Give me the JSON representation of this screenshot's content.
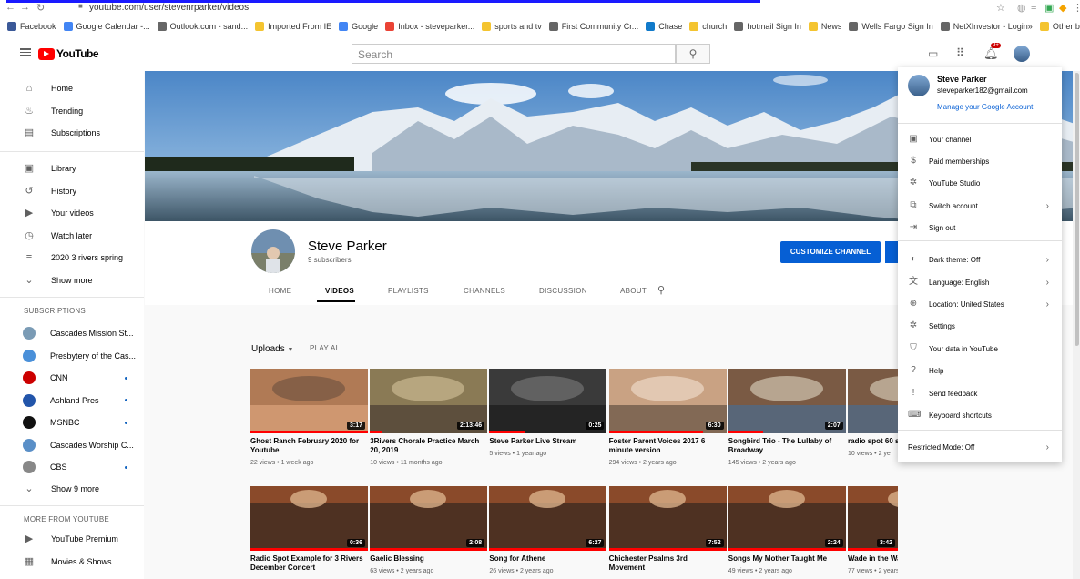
{
  "browser": {
    "url": "youtube.com/user/stevenrparker/videos",
    "bookmarks": [
      {
        "label": "Facebook",
        "color": "#3b5998"
      },
      {
        "label": "Google Calendar -...",
        "color": "#4285f4"
      },
      {
        "label": "Outlook.com - sand...",
        "color": "#666666"
      },
      {
        "label": "Imported From IE",
        "color": "#f4c430"
      },
      {
        "label": "Google",
        "color": "#4285f4"
      },
      {
        "label": "Inbox - steveparker...",
        "color": "#ea4335"
      },
      {
        "label": "sports and tv",
        "color": "#f4c430"
      },
      {
        "label": "First Community Cr...",
        "color": "#666666"
      },
      {
        "label": "Chase",
        "color": "#117aca"
      },
      {
        "label": "church",
        "color": "#f4c430"
      },
      {
        "label": "hotmail Sign In",
        "color": "#666666"
      },
      {
        "label": "News",
        "color": "#f4c430"
      },
      {
        "label": "Wells Fargo Sign In",
        "color": "#666666"
      },
      {
        "label": "NetXInvestor - Login",
        "color": "#666666"
      }
    ],
    "other_bookmarks": "Other bookmarks",
    "overflow": "»"
  },
  "masthead": {
    "logo_text": "YouTube",
    "search_placeholder": "Search",
    "notification_count": "9+"
  },
  "sidebar": {
    "main": [
      {
        "label": "Home",
        "icon": "home-icon",
        "glyph": "⌂"
      },
      {
        "label": "Trending",
        "icon": "flame-icon",
        "glyph": "♨"
      },
      {
        "label": "Subscriptions",
        "icon": "subscriptions-icon",
        "glyph": "▤"
      }
    ],
    "library": [
      {
        "label": "Library",
        "icon": "library-icon",
        "glyph": "▣"
      },
      {
        "label": "History",
        "icon": "history-icon",
        "glyph": "↺"
      },
      {
        "label": "Your videos",
        "icon": "your-videos-icon",
        "glyph": "▶"
      },
      {
        "label": "Watch later",
        "icon": "clock-icon",
        "glyph": "◷"
      },
      {
        "label": "2020 3 rivers spring",
        "icon": "playlist-icon",
        "glyph": "≡"
      },
      {
        "label": "Show more",
        "icon": "chevron-down-icon",
        "glyph": "⌄"
      }
    ],
    "subscriptions_header": "SUBSCRIPTIONS",
    "subscriptions": [
      {
        "label": "Cascades Mission St...",
        "color": "#7a9bb5",
        "live": false
      },
      {
        "label": "Presbytery of the Cas...",
        "color": "#4a90d9",
        "live": false
      },
      {
        "label": "CNN",
        "color": "#cc0000",
        "live": true
      },
      {
        "label": "Ashland Pres",
        "color": "#2255aa",
        "live": true
      },
      {
        "label": "MSNBC",
        "color": "#111111",
        "live": true
      },
      {
        "label": "Cascades Worship C...",
        "color": "#5a8fc7",
        "live": false
      },
      {
        "label": "CBS",
        "color": "#888888",
        "live": true
      }
    ],
    "show_more_subs": "Show 9 more",
    "more_header": "MORE FROM YOUTUBE",
    "more": [
      {
        "label": "YouTube Premium",
        "icon": "youtube-premium-icon",
        "glyph": "▶"
      },
      {
        "label": "Movies & Shows",
        "icon": "film-icon",
        "glyph": "▦"
      }
    ]
  },
  "channel": {
    "name": "Steve Parker",
    "subscribers": "9 subscribers",
    "customize_label": "CUSTOMIZE CHANNEL",
    "tabs": [
      "HOME",
      "VIDEOS",
      "PLAYLISTS",
      "CHANNELS",
      "DISCUSSION",
      "ABOUT"
    ],
    "active_tab": "VIDEOS"
  },
  "uploads": {
    "label": "Uploads",
    "play_all": "PLAY ALL",
    "videos": [
      {
        "title": "Ghost Ranch February 2020 for Youtube",
        "meta": "22 views • 1 week ago",
        "duration": "3:17",
        "progress": 1.0
      },
      {
        "title": "3Rivers Chorale Practice March 20, 2019",
        "meta": "10 views • 11 months ago",
        "duration": "2:13:46",
        "progress": 0.1
      },
      {
        "title": "Steve Parker Live Stream",
        "meta": "5 views • 1 year ago",
        "duration": "0:25",
        "progress": 0.3
      },
      {
        "title": "Foster Parent Voices 2017 6 minute version",
        "meta": "294 views • 2 years ago",
        "duration": "6:30",
        "progress": 0.8
      },
      {
        "title": "Songbird Trio - The Lullaby of Broadway",
        "meta": "145 views • 2 years ago",
        "duration": "2:07",
        "progress": 0.3
      },
      {
        "title": "radio spot 60 s",
        "meta": "10 views • 2 ye",
        "duration": "",
        "progress": 0.0
      },
      {
        "title": "Radio Spot Example for 3 Rivers December Concert",
        "meta": "",
        "duration": "0:36",
        "progress": 1.0
      },
      {
        "title": "Gaelic Blessing",
        "meta": "63 views • 2 years ago",
        "duration": "2:08",
        "progress": 1.0
      },
      {
        "title": "Song for Athene",
        "meta": "26 views • 2 years ago",
        "duration": "6:27",
        "progress": 1.0
      },
      {
        "title": "Chichester Psalms 3rd Movement",
        "meta": "",
        "duration": "7:52",
        "progress": 1.0
      },
      {
        "title": "Songs My Mother Taught Me",
        "meta": "49 views • 2 years ago",
        "duration": "2:24",
        "progress": 1.0
      },
      {
        "title": "Wade in the Water",
        "meta": "77 views • 2 years ago",
        "duration": "3:42",
        "progress": 1.0
      }
    ]
  },
  "account_menu": {
    "name": "Steve Parker",
    "email": "steveparker182@gmail.com",
    "manage": "Manage your Google Account",
    "items": [
      {
        "label": "Your channel",
        "icon": "person-box-icon",
        "glyph": "▣",
        "chevron": false
      },
      {
        "label": "Paid memberships",
        "icon": "dollar-icon",
        "glyph": "$",
        "chevron": false
      },
      {
        "label": "YouTube Studio",
        "icon": "gear-icon",
        "glyph": "✲",
        "chevron": false
      },
      {
        "label": "Switch account",
        "icon": "switch-account-icon",
        "glyph": "⧉",
        "chevron": true
      },
      {
        "label": "Sign out",
        "icon": "sign-out-icon",
        "glyph": "⇥",
        "chevron": false
      },
      {
        "label": "Dark theme: Off",
        "icon": "dark-theme-icon",
        "glyph": "◐",
        "chevron": true
      },
      {
        "label": "Language: English",
        "icon": "translate-icon",
        "glyph": "文",
        "chevron": true
      },
      {
        "label": "Location: United States",
        "icon": "globe-icon",
        "glyph": "⊕",
        "chevron": true
      },
      {
        "label": "Settings",
        "icon": "settings-icon",
        "glyph": "✲",
        "chevron": false
      },
      {
        "label": "Your data in YouTube",
        "icon": "shield-icon",
        "glyph": "⛉",
        "chevron": false
      },
      {
        "label": "Help",
        "icon": "help-icon",
        "glyph": "?",
        "chevron": false
      },
      {
        "label": "Send feedback",
        "icon": "feedback-icon",
        "glyph": "!",
        "chevron": false
      },
      {
        "label": "Keyboard shortcuts",
        "icon": "keyboard-icon",
        "glyph": "⌨",
        "chevron": false
      }
    ],
    "restricted": "Restricted Mode: Off"
  }
}
